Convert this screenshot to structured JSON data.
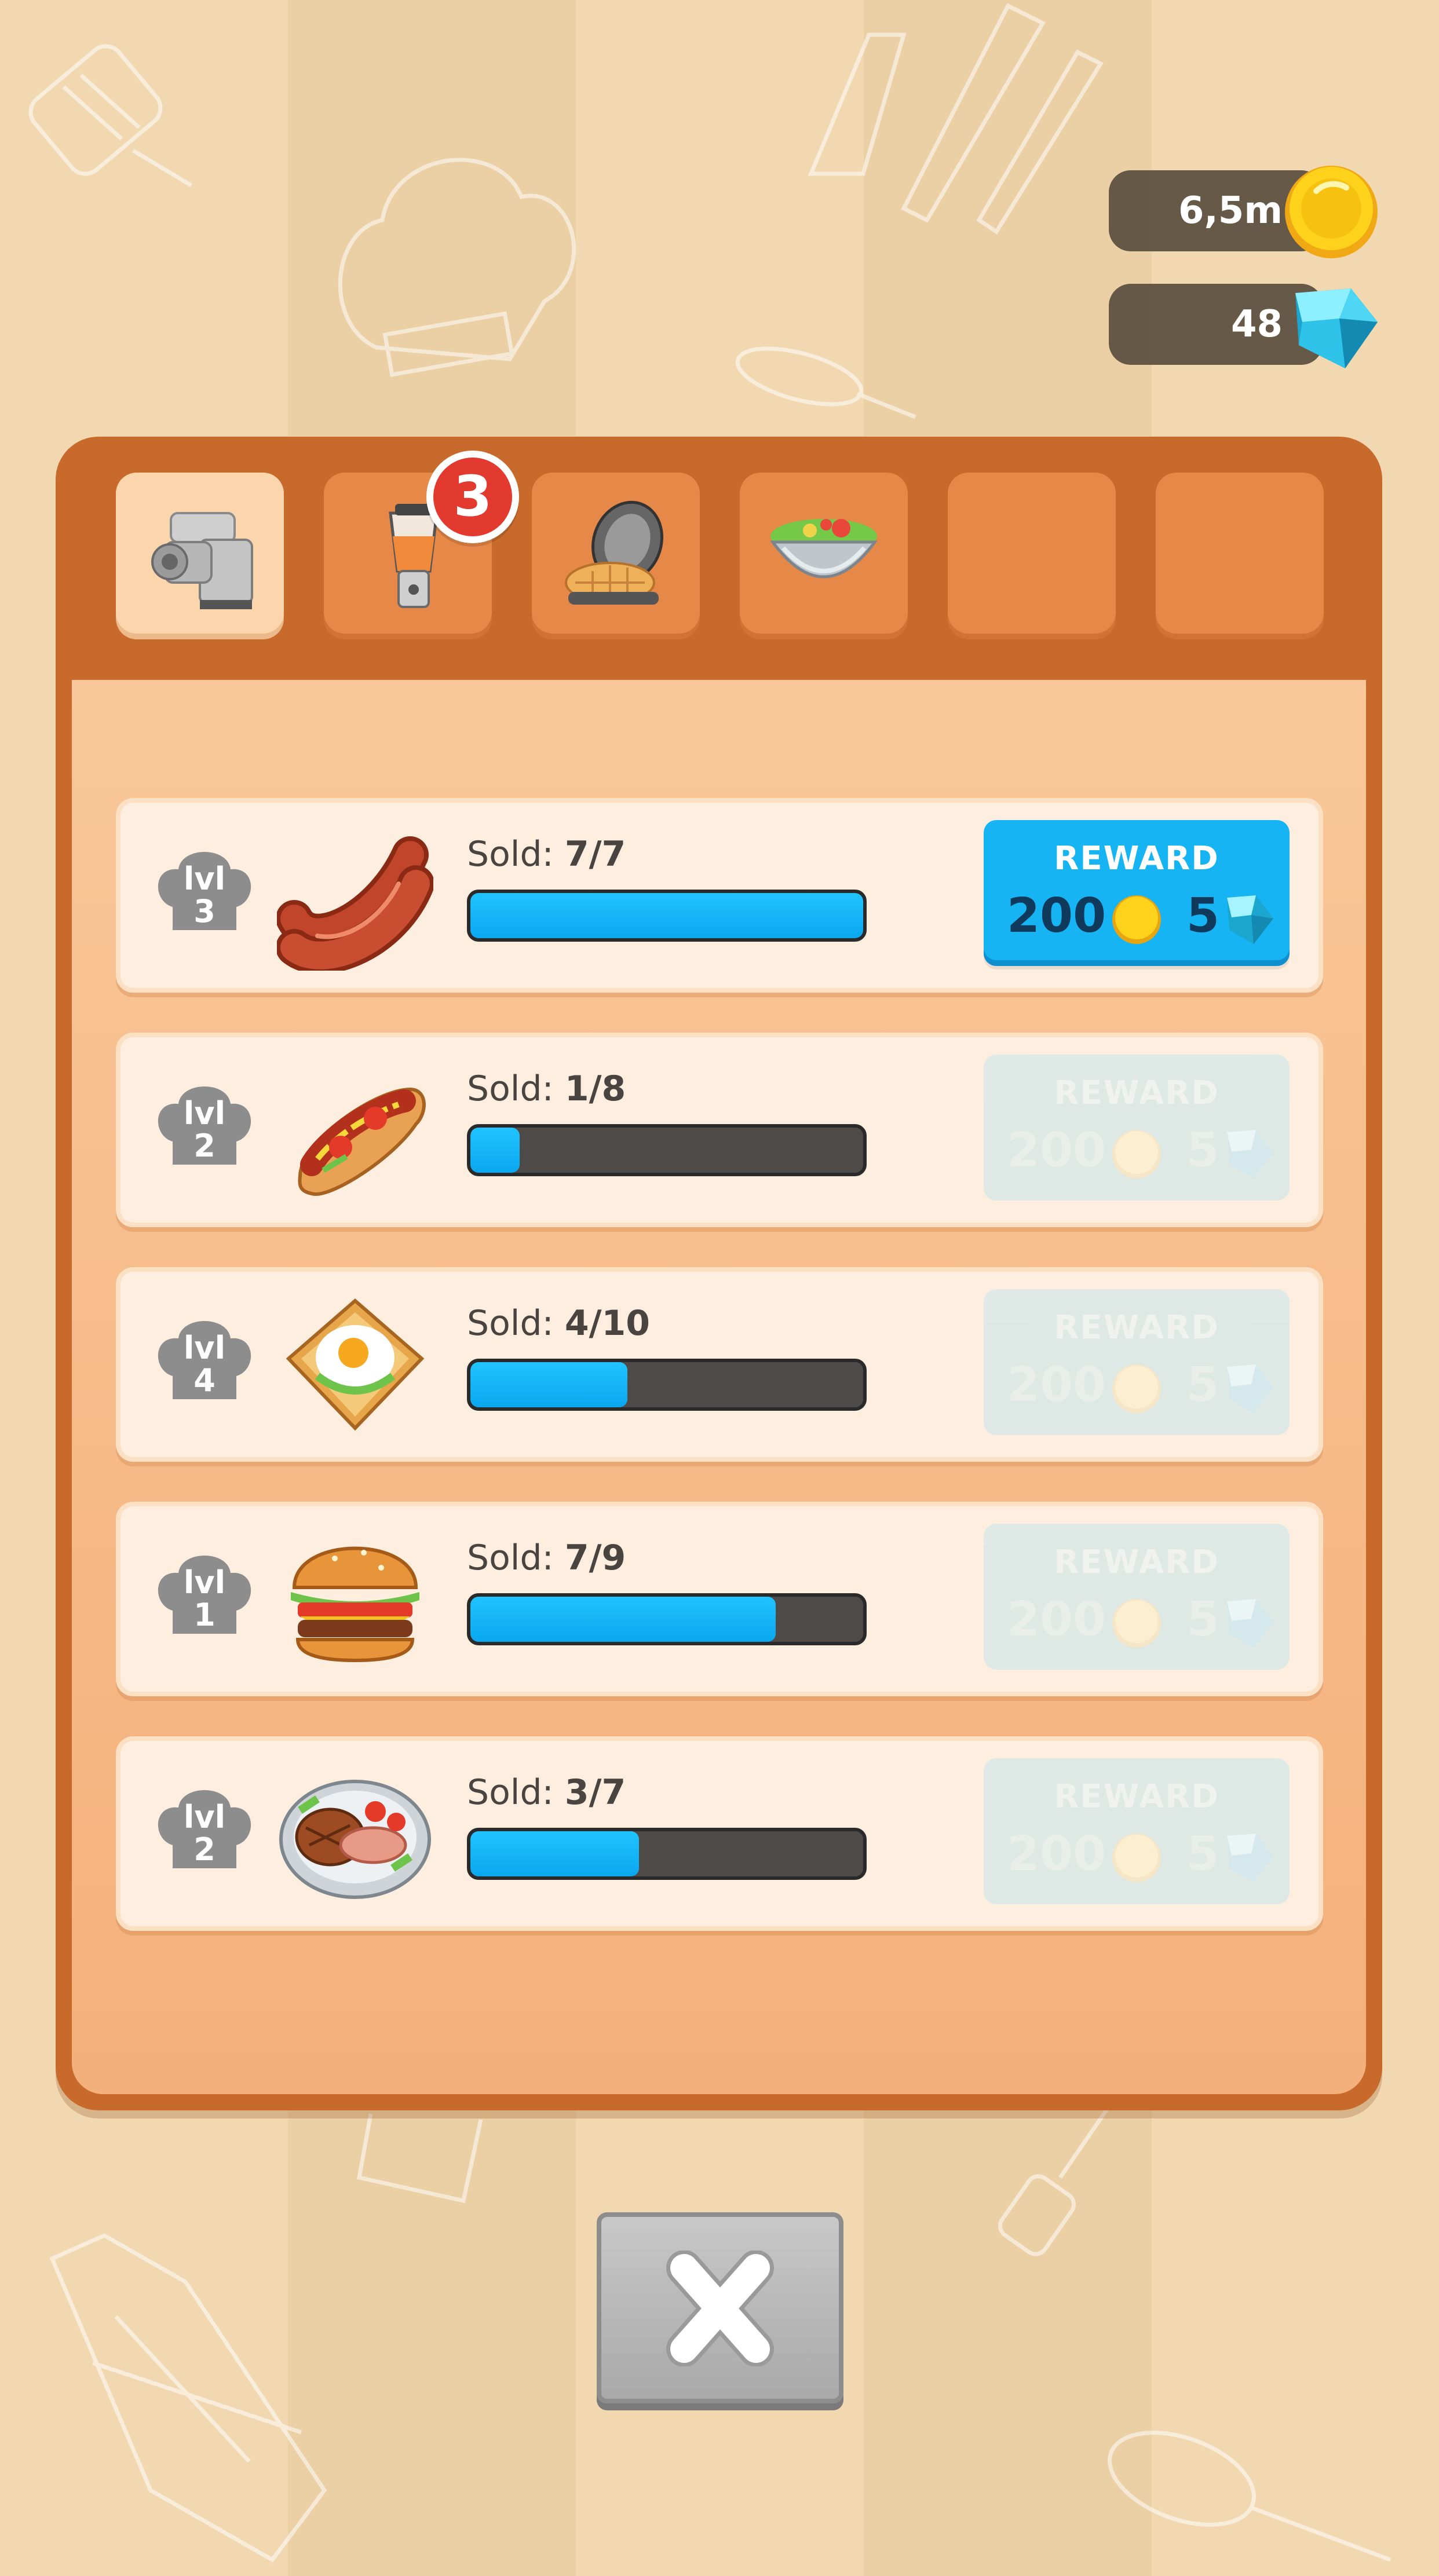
{
  "currency": {
    "coins": "6,5m",
    "gems": "48"
  },
  "tabs": [
    {
      "name": "meat-grinder",
      "active": true
    },
    {
      "name": "blender",
      "badge": "3"
    },
    {
      "name": "waffle-maker"
    },
    {
      "name": "salad-bowl"
    },
    {
      "name": "empty"
    },
    {
      "name": "empty"
    }
  ],
  "rows": [
    {
      "level_label": "lvl",
      "level": "3",
      "food": "sausages-icon",
      "sold_label": "Sold:",
      "sold": "7/7",
      "progress": 1.0,
      "reward_title": "REWARD",
      "reward_coins": "200",
      "reward_gems": "5",
      "enabled": true
    },
    {
      "level_label": "lvl",
      "level": "2",
      "food": "hotdog-icon",
      "sold_label": "Sold:",
      "sold": "1/8",
      "progress": 0.125,
      "reward_title": "REWARD",
      "reward_coins": "200",
      "reward_gems": "5",
      "enabled": false
    },
    {
      "level_label": "lvl",
      "level": "4",
      "food": "egg-toast-icon",
      "sold_label": "Sold:",
      "sold": "4/10",
      "progress": 0.4,
      "reward_title": "REWARD",
      "reward_coins": "200",
      "reward_gems": "5",
      "enabled": false
    },
    {
      "level_label": "lvl",
      "level": "1",
      "food": "burger-icon",
      "sold_label": "Sold:",
      "sold": "7/9",
      "progress": 0.778,
      "reward_title": "REWARD",
      "reward_coins": "200",
      "reward_gems": "5",
      "enabled": false
    },
    {
      "level_label": "lvl",
      "level": "2",
      "food": "steak-plate-icon",
      "sold_label": "Sold:",
      "sold": "3/7",
      "progress": 0.429,
      "reward_title": "REWARD",
      "reward_coins": "200",
      "reward_gems": "5",
      "enabled": false
    }
  ],
  "colors": {
    "panel": "#c86a2c",
    "progress_fill": "#0aa7ef",
    "reward_active": "#17b4f4",
    "badge": "#e23a2e"
  }
}
